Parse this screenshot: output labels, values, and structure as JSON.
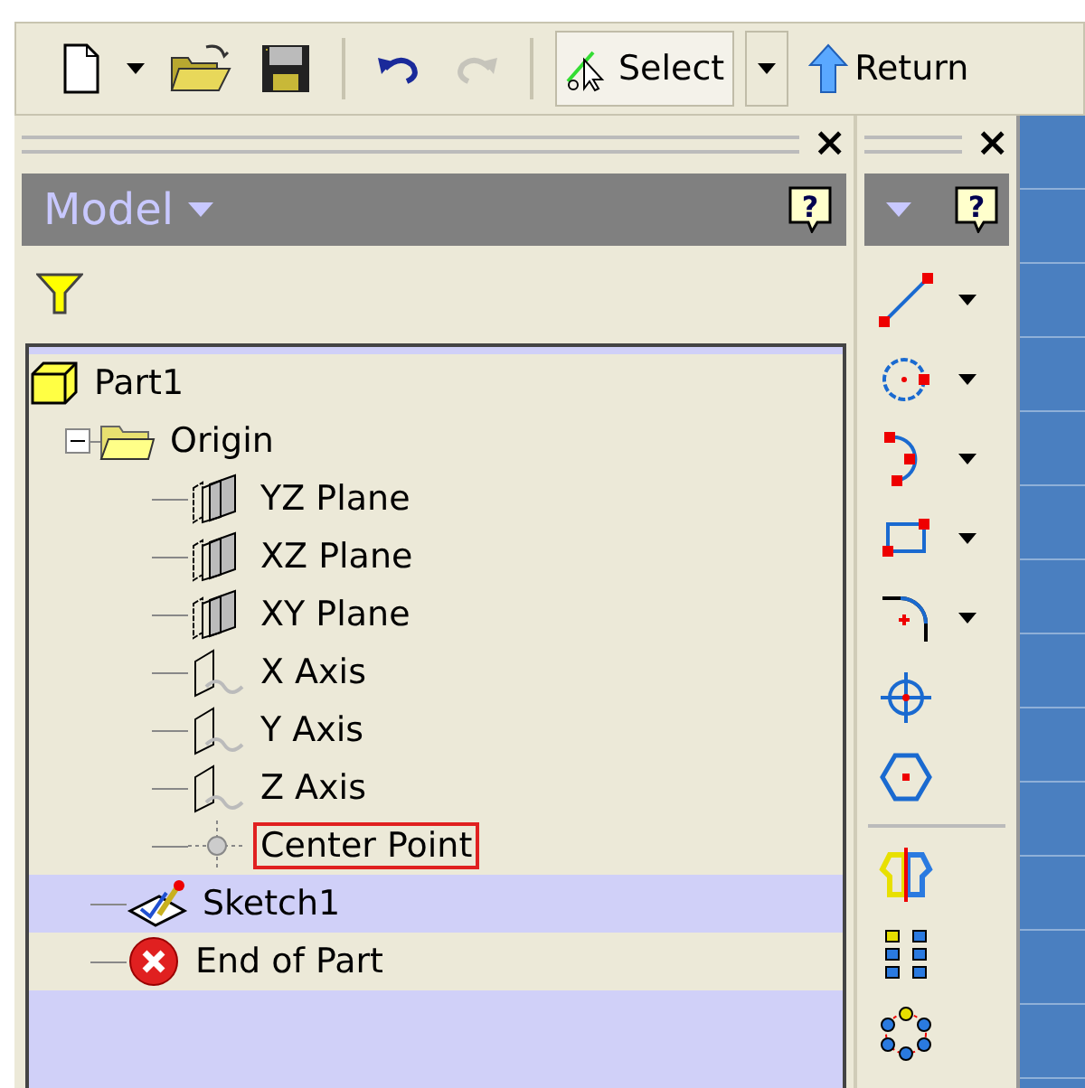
{
  "toolbar": {
    "items": [
      {
        "kind": "new",
        "dropdown": true,
        "disabled": false
      },
      {
        "kind": "open",
        "disabled": false
      },
      {
        "kind": "save",
        "disabled": false
      },
      {
        "kind": "separator"
      },
      {
        "kind": "undo",
        "disabled": false
      },
      {
        "kind": "redo",
        "disabled": true
      },
      {
        "kind": "separator"
      },
      {
        "kind": "select",
        "label": "Select",
        "selected": true,
        "dropdown": true
      },
      {
        "kind": "return",
        "label": "Return"
      }
    ]
  },
  "model_panel": {
    "close": "×",
    "help": "?",
    "title": "Model",
    "tree": [
      {
        "kind": "part",
        "label": "Part1",
        "highlighted": false,
        "boxed": false,
        "children": [
          {
            "kind": "folder",
            "label": "Origin",
            "expanded": true,
            "highlighted": false,
            "boxed": false,
            "children": [
              {
                "kind": "plane",
                "label": "YZ Plane",
                "highlighted": false,
                "boxed": false
              },
              {
                "kind": "plane",
                "label": "XZ Plane",
                "highlighted": false,
                "boxed": false
              },
              {
                "kind": "plane",
                "label": "XY Plane",
                "highlighted": false,
                "boxed": false
              },
              {
                "kind": "axis",
                "label": "X Axis",
                "highlighted": false,
                "boxed": false
              },
              {
                "kind": "axis",
                "label": "Y Axis",
                "highlighted": false,
                "boxed": false
              },
              {
                "kind": "axis",
                "label": "Z Axis",
                "highlighted": false,
                "boxed": false
              },
              {
                "kind": "point",
                "label": "Center Point",
                "highlighted": false,
                "boxed": true
              }
            ]
          },
          {
            "kind": "sketch",
            "label": "Sketch1",
            "highlighted": true,
            "boxed": false
          },
          {
            "kind": "end",
            "label": "End of Part",
            "highlighted": false,
            "boxed": false
          }
        ]
      }
    ]
  },
  "tools_panel": {
    "close": "×",
    "help": "?",
    "tools": [
      {
        "kind": "line",
        "dropdown": true
      },
      {
        "kind": "circle",
        "dropdown": true
      },
      {
        "kind": "arc",
        "dropdown": true
      },
      {
        "kind": "rectangle",
        "dropdown": true
      },
      {
        "kind": "fillet",
        "dropdown": true
      },
      {
        "kind": "point"
      },
      {
        "kind": "polygon"
      },
      {
        "kind": "separator"
      },
      {
        "kind": "mirror"
      },
      {
        "kind": "pattern"
      },
      {
        "kind": "circular"
      }
    ]
  }
}
